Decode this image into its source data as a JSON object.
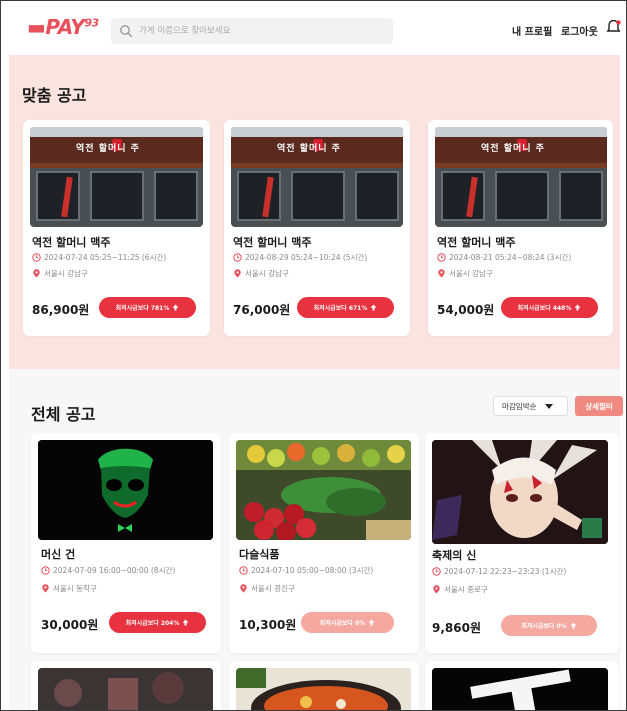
{
  "header": {
    "logo_text": "PAY",
    "logo_suffix": "93",
    "search_placeholder": "가게 이름으로 찾아보세요",
    "profile_label": "내 프로필",
    "logout_label": "로그아웃"
  },
  "matched": {
    "title": "맞춤 공고",
    "cards": [
      {
        "name": "역전 할머니 맥주",
        "datetime": "2024-07-24 05:25~11:25 (6시간)",
        "location": "서울시 강남구",
        "price": "86,900원",
        "badge": "최저시급보다 781%"
      },
      {
        "name": "역전 할머니 맥주",
        "datetime": "2024-08-29 05:24~10:24 (5시간)",
        "location": "서울시 강남구",
        "price": "76,000원",
        "badge": "최저시급보다 671%"
      },
      {
        "name": "역전 할머니 맥주",
        "datetime": "2024-08-21 05:24~08:24 (3시간)",
        "location": "서울시 강남구",
        "price": "54,000원",
        "badge": "최저시급보다 448%"
      }
    ],
    "store_sign": "역전 할머니 주"
  },
  "all": {
    "title": "전체 공고",
    "sort_value": "마감임박순",
    "filter_label": "상세필터",
    "cards": [
      {
        "name": "머신 건",
        "datetime": "2024-07-09 16:00~00:00 (8시간)",
        "location": "서울시 동작구",
        "price": "30,000원",
        "badge": "최저시급보다 204%",
        "pale": false
      },
      {
        "name": "다슬식품",
        "datetime": "2024-07-10 05:00~08:00 (3시간)",
        "location": "서울시 광진구",
        "price": "10,300원",
        "badge": "최저시급보다 0%",
        "pale": true
      },
      {
        "name": "축제의 신",
        "datetime": "2024-07-12 22:23~23:23 (1시간)",
        "location": "서울시 종로구",
        "price": "9,860원",
        "badge": "최저시급보다 0%",
        "pale": true
      }
    ]
  },
  "colors": {
    "brand": "#e8505b",
    "badge": "#e8323f",
    "badge_pale": "#f5a8a0",
    "matched_bg": "#fbe3df"
  }
}
